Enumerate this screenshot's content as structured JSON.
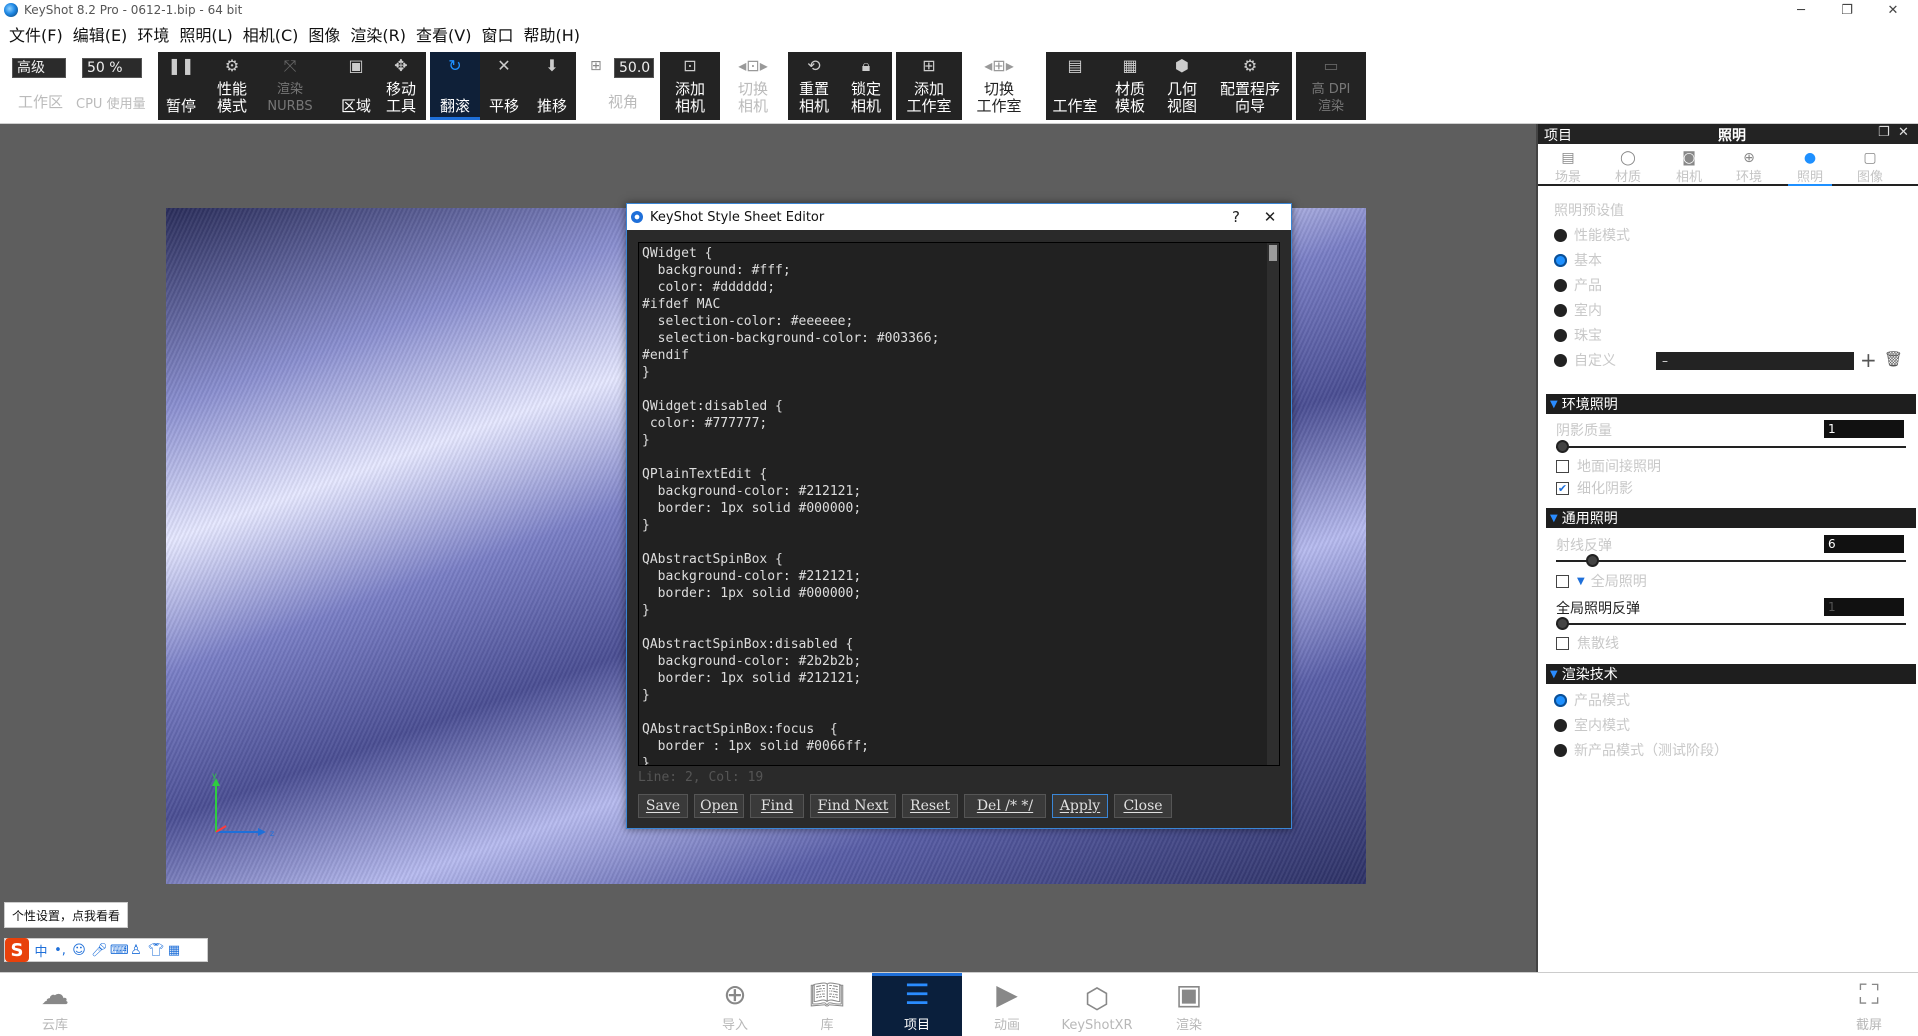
{
  "window": {
    "title": "KeyShot 8.2 Pro  - 0612-1.bip  - 64 bit",
    "minimize_icon": "─",
    "restore_icon": "❐",
    "close_icon": "✕"
  },
  "menu": [
    "文件(F)",
    "编辑(E)",
    "环境",
    "照明(L)",
    "相机(C)",
    "图像",
    "渲染(R)",
    "查看(V)",
    "窗口",
    "帮助(H)"
  ],
  "ribbon": {
    "quality_select": "高级",
    "workspace_label": "工作区",
    "cpu_select": "50 %",
    "cpu_label": "CPU 使用量",
    "pause": "暂停",
    "perf_mode": "性能\n模式",
    "render_nurbs": "渲染\nNURBS",
    "region": "区域",
    "move_tool": "移动\n工具",
    "tumble": "翻滚",
    "pan": "平移",
    "dolly": "推移",
    "fov_value": "50.0",
    "fov_label": "视角",
    "add_camera": "添加\n相机",
    "switch_camera": "切换\n相机",
    "reset_camera": "重置\n相机",
    "lock_camera": "锁定\n相机",
    "add_studio": "添加\n工作室",
    "switch_studio": "切换\n工作室",
    "studio": "工作室",
    "material_template": "材质\n模板",
    "geometry_view": "几何\n视图",
    "config_wizard": "配置程序\n向导",
    "hidpi_render": "高 DPI\n渲染"
  },
  "dialog": {
    "title": "KeyShot Style Sheet Editor",
    "help": "?",
    "close": "✕",
    "code": "QWidget {\n  background: #fff;\n  color: #dddddd;\n#ifdef MAC\n  selection-color: #eeeeee;\n  selection-background-color: #003366;\n#endif\n}\n\nQWidget:disabled {\n color: #777777;\n}\n\nQPlainTextEdit {\n  background-color: #212121;\n  border: 1px solid #000000;\n}\n\nQAbstractSpinBox {\n  background-color: #212121;\n  border: 1px solid #000000;\n}\n\nQAbstractSpinBox:disabled {\n  background-color: #2b2b2b;\n  border: 1px solid #212121;\n}\n\nQAbstractSpinBox:focus  {\n  border : 1px solid #0066ff;\n}",
    "status": "Line: 2, Col: 19",
    "buttons": {
      "save": "Save",
      "open": "Open",
      "find": "Find",
      "find_next": "Find Next",
      "reset": "Reset",
      "del": "Del /* */",
      "apply": "Apply",
      "close": "Close"
    }
  },
  "ime": {
    "tip": "个性设置，点我看看",
    "logo": "S",
    "lang": "中"
  },
  "bottom": {
    "cloud": "云库",
    "import": "导入",
    "library": "库",
    "project": "项目",
    "animation": "动画",
    "keyshotxr": "KeyShotXR",
    "render": "渲染",
    "screenshot": "截屏"
  },
  "panel": {
    "left_title": "项目",
    "title": "照明",
    "tabs": [
      "场景",
      "材质",
      "相机",
      "环境",
      "照明",
      "图像"
    ],
    "presets_label": "照明预设值",
    "presets": [
      "性能模式",
      "基本",
      "产品",
      "室内",
      "珠宝",
      "自定义"
    ],
    "custom_value": "–",
    "env_lighting": "环境照明",
    "shadow_quality": "阴影质量",
    "shadow_quality_value": "1",
    "ground_indirect": "地面间接照明",
    "fine_shadows": "细化阴影",
    "general_lighting": "通用照明",
    "ray_bounces": "射线反弹",
    "ray_bounces_value": "6",
    "global_illumination": "全局照明",
    "gi_bounces": "全局照明反弹",
    "gi_bounces_value": "1",
    "caustics": "焦散线",
    "render_tech": "渲染技术",
    "techniques": [
      "产品模式",
      "室内模式",
      "新产品模式（测试阶段）"
    ]
  },
  "colors": {
    "accent": "#1e90ff",
    "toolbar_bg": "#232323",
    "editor_bg": "#212121"
  }
}
